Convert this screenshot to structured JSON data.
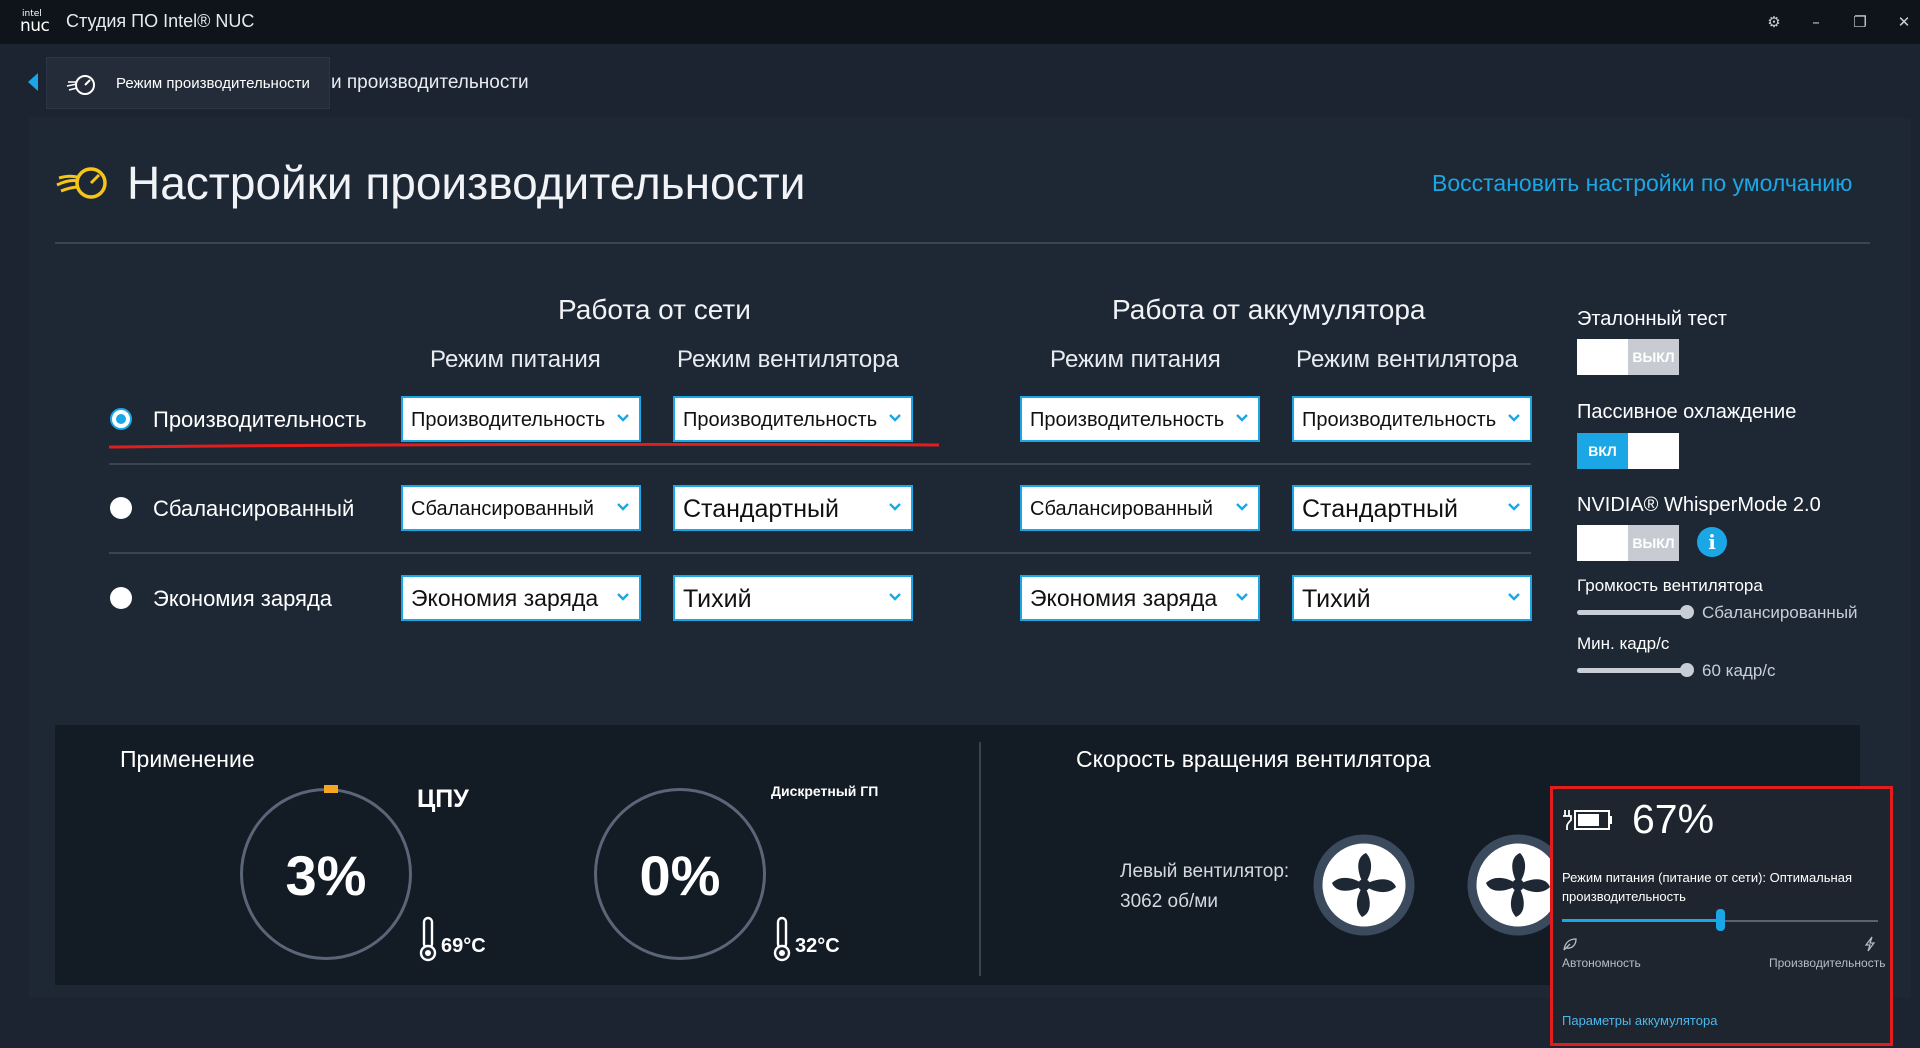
{
  "window": {
    "logo_intel": "intel",
    "logo_nuc": "nuc",
    "title": "Студия ПО Intel® NUC",
    "settings_glyph": "⚙",
    "minimize_glyph": "–",
    "restore_glyph": "❐",
    "close_glyph": "✕"
  },
  "breadcrumb": {
    "tooltip": "Режим производительности",
    "text": "и производительности"
  },
  "header": {
    "title": "Настройки производительности",
    "reset_link": "Восстановить настройки по умолчанию"
  },
  "groups": {
    "ac": {
      "title": "Работа от сети",
      "power_col": "Режим питания",
      "fan_col": "Режим вентилятора"
    },
    "battery": {
      "title": "Работа от аккумулятора",
      "power_col": "Режим питания",
      "fan_col": "Режим вентилятора"
    }
  },
  "profiles": [
    {
      "label": "Производительность",
      "selected": true,
      "ac_power": "Производительность",
      "ac_fan": "Производительность",
      "bat_power": "Производительность",
      "bat_fan": "Производительность"
    },
    {
      "label": "Сбалансированный",
      "selected": false,
      "ac_power": "Сбалансированный",
      "ac_fan": "Стандартный",
      "bat_power": "Сбалансированный",
      "bat_fan": "Стандартный"
    },
    {
      "label": "Экономия заряда",
      "selected": false,
      "ac_power": "Экономия заряда",
      "ac_fan": "Тихий",
      "bat_power": "Экономия заряда",
      "bat_fan": "Тихий"
    }
  ],
  "settings": {
    "benchmark": {
      "label": "Эталонный тест",
      "state": "ВЫКЛ"
    },
    "passive_cooling": {
      "label": "Пассивное охлаждение",
      "state": "ВКЛ"
    },
    "whisper_mode": {
      "label": "NVIDIA® WhisperMode 2.0",
      "state": "ВЫКЛ",
      "info_glyph": "i"
    },
    "fan_volume": {
      "label": "Громкость вентилятора",
      "value": "Сбалансированный"
    },
    "min_fps": {
      "label": "Мин. кадр/с",
      "value": "60 кадр/с"
    }
  },
  "usage": {
    "title": "Применение",
    "cpu": {
      "label": "ЦПУ",
      "value": "3%",
      "temp": "69°C"
    },
    "gpu": {
      "label": "Дискретный ГП",
      "value": "0%",
      "temp": "32°C"
    }
  },
  "fans": {
    "title": "Скорость вращения вентилятора",
    "left_label": "Левый вентилятор:",
    "left_value": "3062 об/ми"
  },
  "battery_flyout": {
    "percent": "67%",
    "mode_text": "Режим питания (питание от сети): Оптимальная производительность",
    "slider_value": 0.5,
    "left_label": "Автономность",
    "right_label": "Производительность",
    "link": "Параметры аккумулятора"
  },
  "colors": {
    "accent": "#1ba7e6",
    "background": "#1b2430",
    "highlight": "#e21d1d",
    "cpu_indicator": "#f5a623"
  }
}
